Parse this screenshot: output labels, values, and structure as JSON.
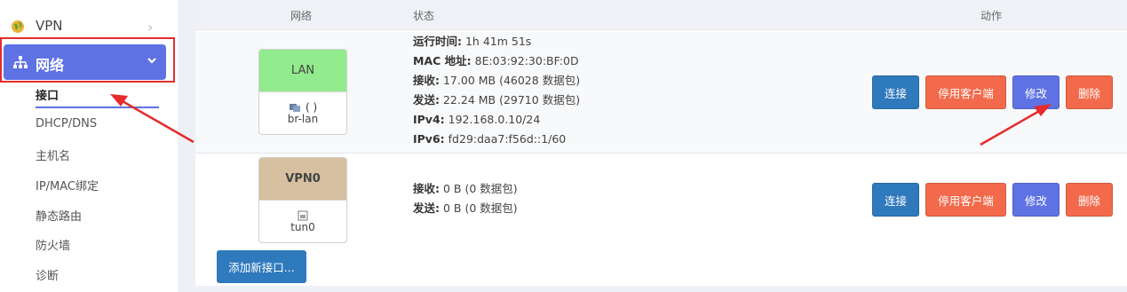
{
  "sidebar": {
    "vpn_label": "VPN",
    "network_label": "网络",
    "sub_items": [
      "接口",
      "DHCP/DNS",
      "主机名",
      "IP/MAC绑定",
      "静态路由",
      "防火墙",
      "诊断"
    ]
  },
  "table": {
    "headers": {
      "network": "网络",
      "status": "状态",
      "action": "动作"
    }
  },
  "interfaces": [
    {
      "name": "LAN",
      "icon_text": "(  )",
      "device": "br-lan",
      "color": "#92ec8d",
      "status_keys": [
        "运行时间:",
        "MAC 地址:",
        "接收:",
        "发送:",
        "IPv4:",
        "IPv6:"
      ],
      "status_vals": [
        "1h 41m 51s",
        "8E:03:92:30:BF:0D",
        "17.00 MB (46028 数据包)",
        "22.24 MB (29710 数据包)",
        "192.168.0.10/24",
        "fd29:daa7:f56d::1/60"
      ]
    },
    {
      "name": "VPN0",
      "device": "tun0",
      "color": "#d6c0a0",
      "status_keys": [
        "接收:",
        "发送:"
      ],
      "status_vals": [
        "0 B (0 数据包)",
        "0 B (0 数据包)"
      ]
    }
  ],
  "actions": {
    "connect": "连接",
    "stop": "停用客户端",
    "edit": "修改",
    "delete": "删除"
  },
  "add_button": "添加新接口...",
  "colors": {
    "accent": "#5e72e4",
    "blue": "#2f79bd",
    "red": "#f26a4b",
    "highlight": "#e52b2b"
  }
}
